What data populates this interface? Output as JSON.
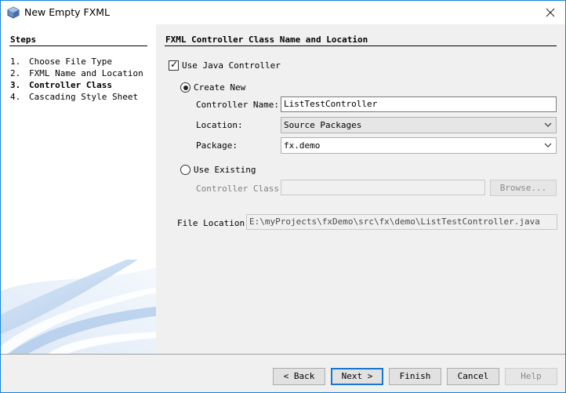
{
  "window": {
    "title": "New Empty FXML"
  },
  "steps": {
    "heading": "Steps",
    "items": [
      {
        "num": "1.",
        "label": "Choose File Type"
      },
      {
        "num": "2.",
        "label": "FXML Name and Location"
      },
      {
        "num": "3.",
        "label": "Controller Class"
      },
      {
        "num": "4.",
        "label": "Cascading Style Sheet"
      }
    ]
  },
  "panel": {
    "title": "FXML Controller Class Name and Location",
    "use_java_controller_label": "Use Java Controller",
    "create_new_label": "Create New",
    "controller_name_label": "Controller Name:",
    "controller_name_value": "ListTestController",
    "location_label": "Location:",
    "location_value": "Source Packages",
    "package_label": "Package:",
    "package_value": "fx.demo",
    "use_existing_label": "Use Existing",
    "controller_class_label": "Controller Class:",
    "controller_class_value": "",
    "browse_label": "Browse...",
    "file_location_label": "File Location:",
    "file_location_value": "E:\\myProjects\\fxDemo\\src\\fx\\demo\\ListTestController.java"
  },
  "buttons": {
    "back": "< Back",
    "next": "Next >",
    "finish": "Finish",
    "cancel": "Cancel",
    "help": "Help"
  },
  "colors": {
    "accent": "#1677d2",
    "panel_bg": "#f0f0f0"
  }
}
